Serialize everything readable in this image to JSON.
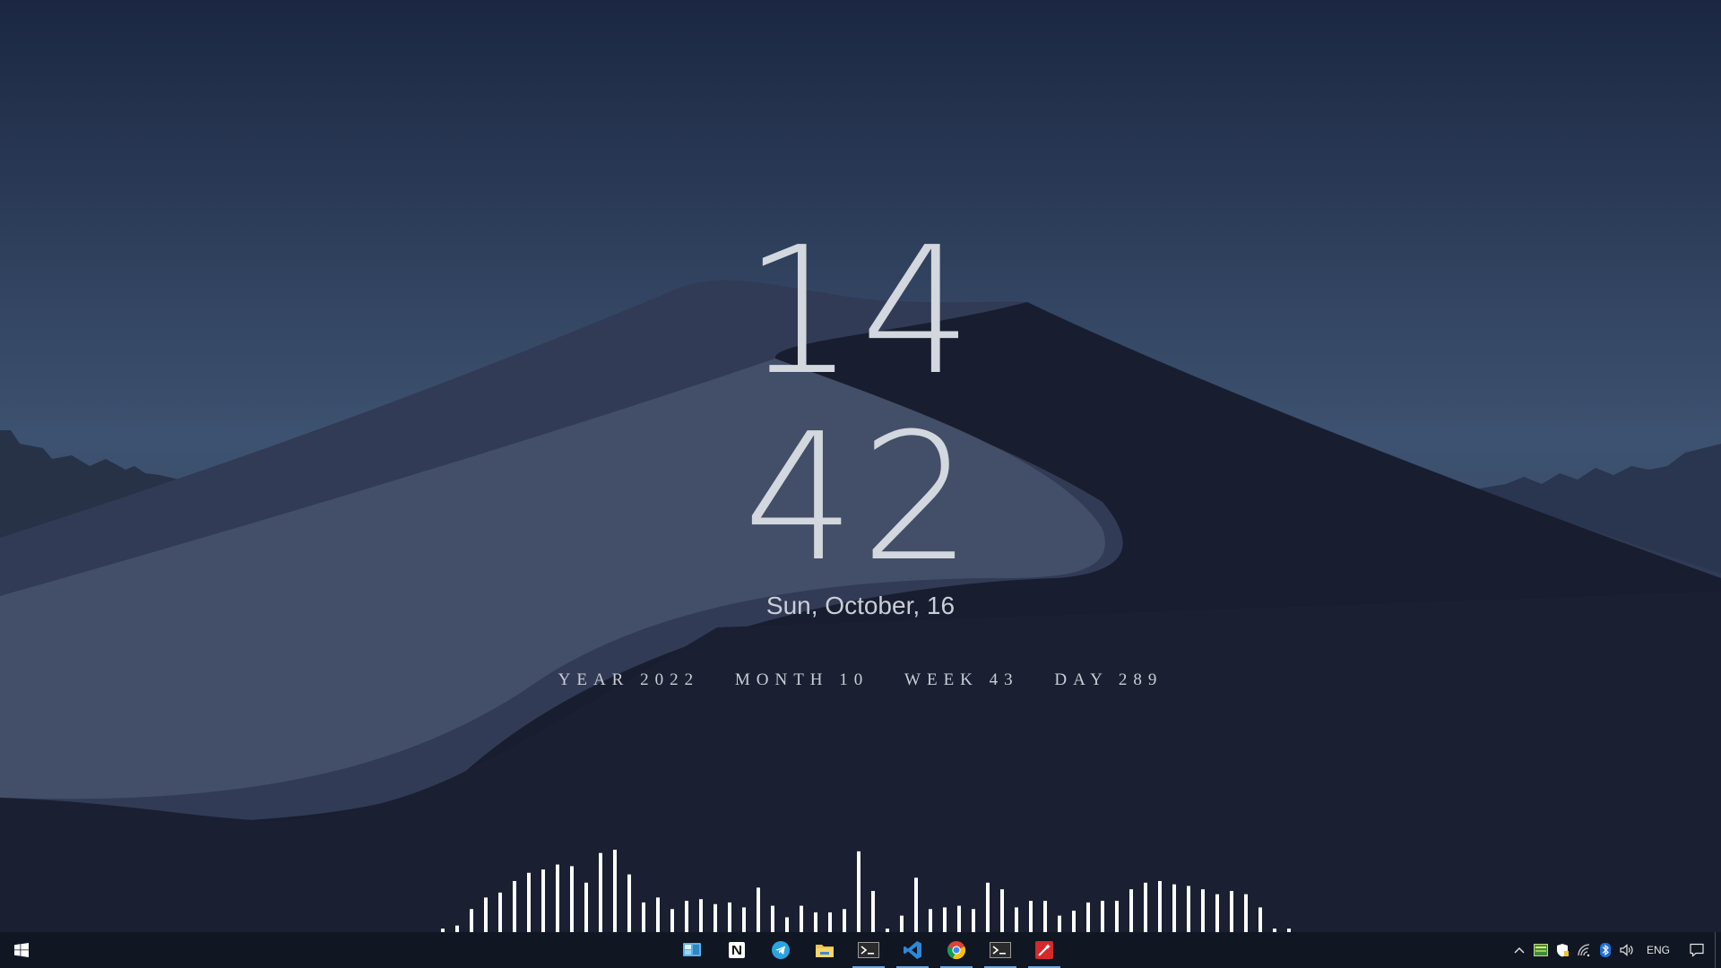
{
  "clock": {
    "hours": "14",
    "minutes": "42",
    "date": "Sun, October, 16"
  },
  "stats": [
    {
      "label": "YEAR",
      "value": "2022"
    },
    {
      "label": "MONTH",
      "value": "10"
    },
    {
      "label": "WEEK",
      "value": "43"
    },
    {
      "label": "DAY",
      "value": "289"
    }
  ],
  "visualizer": {
    "levels": [
      0.04,
      0.08,
      0.28,
      0.42,
      0.48,
      0.62,
      0.72,
      0.76,
      0.82,
      0.8,
      0.6,
      0.96,
      1.0,
      0.7,
      0.36,
      0.42,
      0.28,
      0.38,
      0.4,
      0.34,
      0.36,
      0.3,
      0.54,
      0.32,
      0.18,
      0.32,
      0.24,
      0.24,
      0.28,
      0.98,
      0.5,
      0.04,
      0.2,
      0.66,
      0.28,
      0.3,
      0.32,
      0.28,
      0.6,
      0.52,
      0.3,
      0.38,
      0.38,
      0.2,
      0.26,
      0.36,
      0.38,
      0.38,
      0.52,
      0.6,
      0.62,
      0.58,
      0.56,
      0.52,
      0.46,
      0.5,
      0.46,
      0.3,
      0.04,
      0.04,
      0.04,
      0.04
    ],
    "bar_color": "#ffffff"
  },
  "taskbar": {
    "start_icon": "windows-logo-icon",
    "apps": [
      {
        "name": "control-panel",
        "icon": "control-panel-icon",
        "running": false
      },
      {
        "name": "notion",
        "icon": "notion-icon",
        "running": false
      },
      {
        "name": "telegram",
        "icon": "telegram-icon",
        "running": false
      },
      {
        "name": "file-explorer",
        "icon": "folder-icon",
        "running": false
      },
      {
        "name": "terminal",
        "icon": "terminal-icon",
        "running": true
      },
      {
        "name": "vscode",
        "icon": "vscode-icon",
        "running": true
      },
      {
        "name": "chrome",
        "icon": "chrome-icon",
        "running": true
      },
      {
        "name": "terminal-2",
        "icon": "terminal-icon",
        "running": true
      },
      {
        "name": "magic-tool",
        "icon": "magic-wand-icon",
        "running": true
      }
    ],
    "tray": {
      "icons": [
        "chevron-up-icon",
        "monitor-app-icon",
        "shield-icon",
        "wifi-icon",
        "bluetooth-icon",
        "volume-icon"
      ],
      "language": "ENG",
      "notification_icon": "notification-icon"
    }
  },
  "colors": {
    "sky_top": "#1b2742",
    "sky_bottom": "#3d5270",
    "taskbar": "#101622",
    "clock_text": "#d3d7de",
    "accent": "#6fa8dc"
  }
}
